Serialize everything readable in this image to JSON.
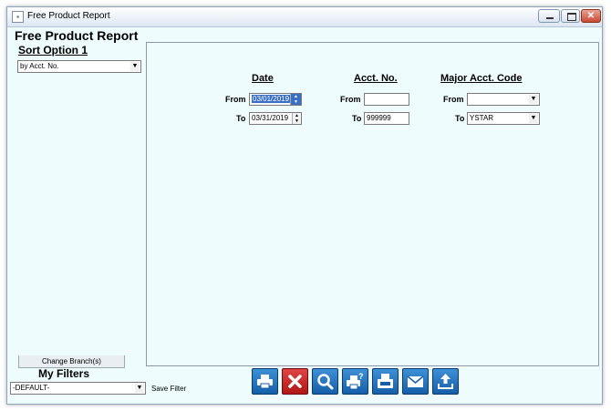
{
  "window": {
    "title": "Free Product Report",
    "icon": "app-icon",
    "controls": {
      "minimize": "minimize-icon",
      "maximize": "maximize-icon",
      "close": "✕"
    }
  },
  "app_title": "Free Product Report",
  "sidebar": {
    "sort_title": "Sort Option 1",
    "sort_value": "by Acct. No.",
    "change_branch_label": "Change Branch(s)"
  },
  "criteria": {
    "date": {
      "heading": "Date",
      "from_label": "From",
      "from_value": "03/01/2019",
      "to_label": "To",
      "to_value": "03/31/2019"
    },
    "acct": {
      "heading": "Acct. No.",
      "from_label": "From",
      "from_value": "",
      "to_label": "To",
      "to_value": "999999"
    },
    "major": {
      "heading": "Major Acct. Code",
      "from_label": "From",
      "from_value": "",
      "to_label": "To",
      "to_value": "YSTAR"
    }
  },
  "filters": {
    "title": "My Filters",
    "value": "-DEFAULT-",
    "save_label": "Save Filter"
  },
  "toolbar": [
    {
      "name": "print-button",
      "icon": "printer-icon"
    },
    {
      "name": "cancel-button",
      "icon": "x-icon"
    },
    {
      "name": "preview-button",
      "icon": "magnifier-icon"
    },
    {
      "name": "print-help-button",
      "icon": "printer-question-icon"
    },
    {
      "name": "fax-button",
      "icon": "fax-icon"
    },
    {
      "name": "email-button",
      "icon": "envelope-icon"
    },
    {
      "name": "export-button",
      "icon": "upload-icon"
    }
  ],
  "colors": {
    "button_blue": "#1f6fb8",
    "cancel_red": "#c92020",
    "window_bg": "#eefcfd"
  }
}
